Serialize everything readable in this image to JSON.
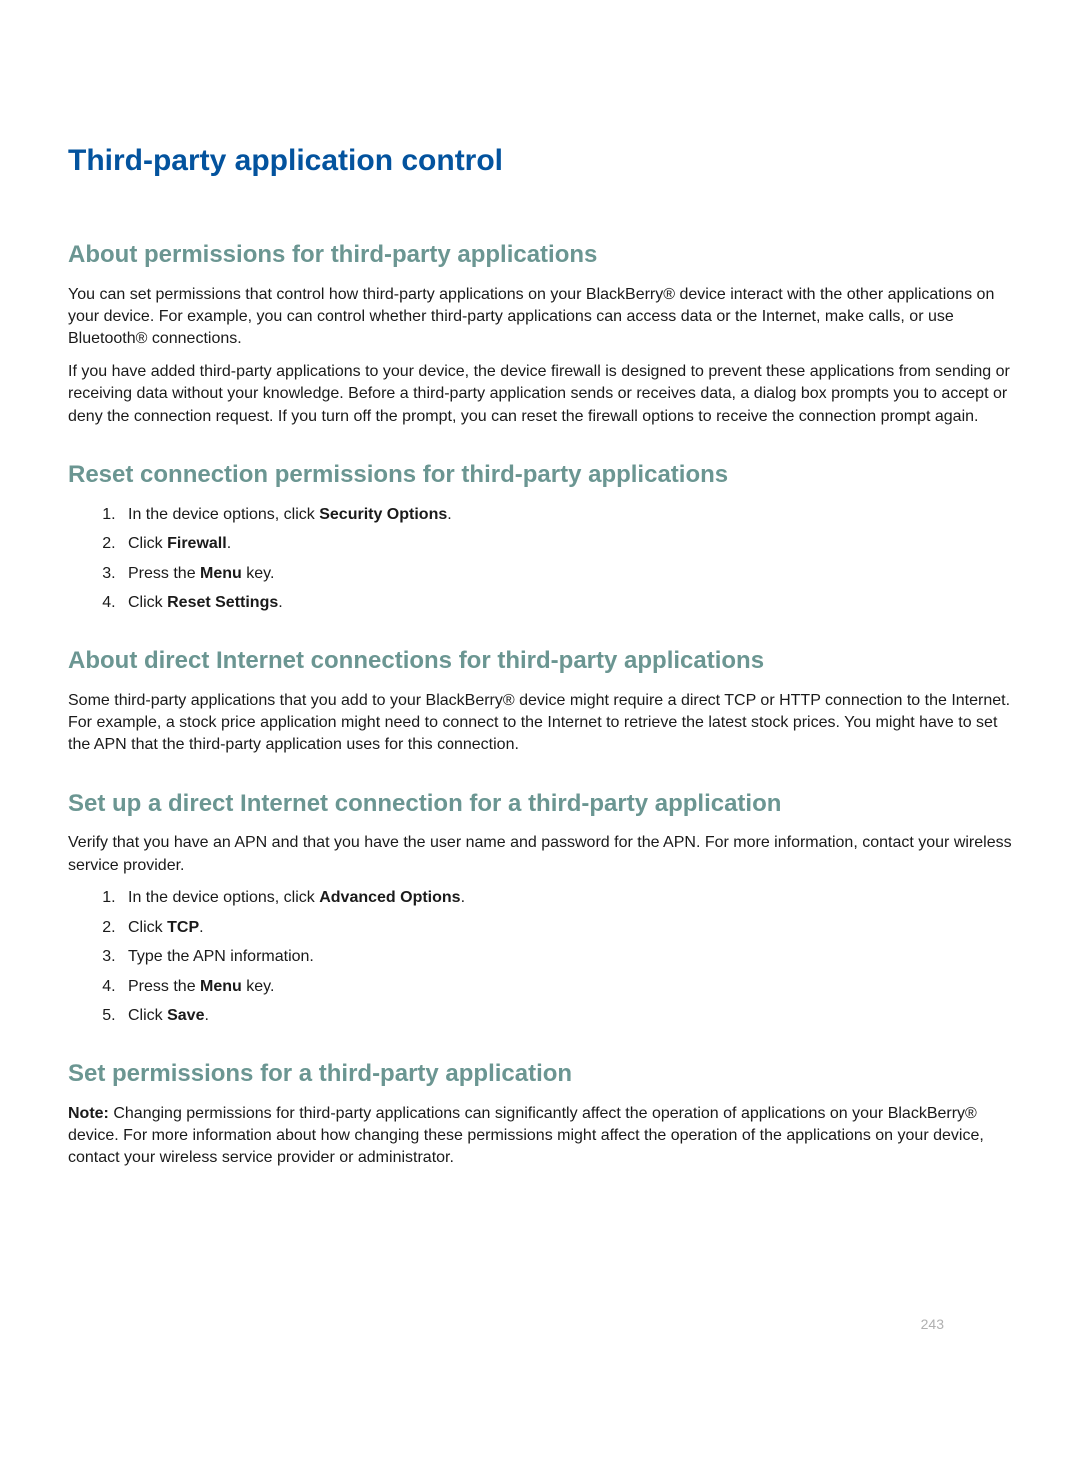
{
  "mainTitle": "Third-party application control",
  "section1": {
    "title": "About permissions for third-party applications",
    "para1": "You can set permissions that control how third-party applications on your BlackBerry® device interact with the other applications on your device. For example, you can control whether third-party applications can access data or the Internet, make calls, or use Bluetooth® connections.",
    "para2": "If you have added third-party applications to your device, the device firewall is designed to prevent these applications from sending or receiving data without your knowledge. Before a third-party application sends or receives data, a dialog box prompts you to accept or deny the connection request. If you turn off the prompt, you can reset the firewall options to receive the connection prompt again."
  },
  "section2": {
    "title": "Reset connection permissions for third-party applications",
    "step1_pre": "In the device options, click ",
    "step1_bold": "Security Options",
    "step1_post": ".",
    "step2_pre": "Click ",
    "step2_bold": "Firewall",
    "step2_post": ".",
    "step3_pre": "Press the ",
    "step3_bold": "Menu",
    "step3_post": " key.",
    "step4_pre": "Click ",
    "step4_bold": "Reset Settings",
    "step4_post": "."
  },
  "section3": {
    "title": "About direct Internet connections for third-party applications",
    "para1": "Some third-party applications that you add to your BlackBerry® device might require a direct TCP or HTTP connection to the Internet. For example, a stock price application might need to connect to the Internet to retrieve the latest stock prices. You might have to set the APN that the third-party application uses for this connection."
  },
  "section4": {
    "title": "Set up a direct Internet connection for a third-party application",
    "intro": "Verify that you have an APN and that you have the user name and password for the APN. For more information, contact your wireless service provider.",
    "step1_pre": "In the device options, click ",
    "step1_bold": "Advanced Options",
    "step1_post": ".",
    "step2_pre": "Click ",
    "step2_bold": "TCP",
    "step2_post": ".",
    "step3": "Type the APN information.",
    "step4_pre": "Press the ",
    "step4_bold": "Menu",
    "step4_post": " key.",
    "step5_pre": "Click ",
    "step5_bold": "Save",
    "step5_post": "."
  },
  "section5": {
    "title": "Set permissions for a third-party application",
    "note_bold": "Note:",
    "note_text": " Changing permissions for third-party applications can significantly affect the operation of applications on your BlackBerry® device. For more information about how changing these permissions might affect the operation of the applications on your device, contact your wireless service provider or administrator."
  },
  "pageNumber": "243"
}
